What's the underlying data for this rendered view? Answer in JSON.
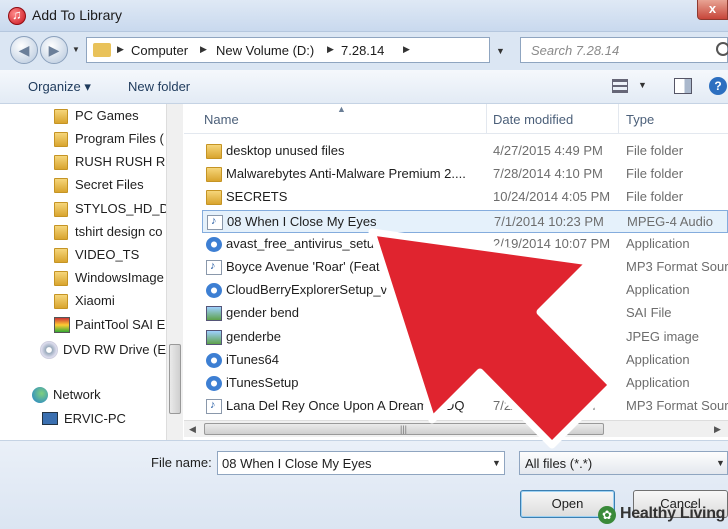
{
  "window": {
    "title": "Add To Library",
    "close_label": "x"
  },
  "nav": {
    "back_glyph": "◀",
    "forward_glyph": "▶",
    "breadcrumbs": [
      "Computer",
      "New Volume (D:)",
      "7.28.14"
    ],
    "search_placeholder": "Search 7.28.14"
  },
  "toolbar": {
    "organize_label": "Organize ▾",
    "new_folder_label": "New folder",
    "help_label": "?"
  },
  "sidebar": {
    "folders": [
      "PC Games",
      "Program Files (",
      "RUSH RUSH RU",
      "Secret Files",
      "STYLOS_HD_DE",
      "tshirt design co",
      "VIDEO_TS",
      "WindowsImage",
      "Xiaomi"
    ],
    "paint_item": "PaintTool SAI E",
    "dvd_item": "DVD RW Drive (E:",
    "network": "Network",
    "pc": "ERVIC-PC"
  },
  "columns": {
    "name": "Name",
    "date": "Date modified",
    "type": "Type"
  },
  "files": [
    {
      "name": "desktop unused files",
      "date": "4/27/2015 4:49 PM",
      "type": "File folder",
      "icon": "folder-icon"
    },
    {
      "name": "Malwarebytes Anti-Malware Premium 2....",
      "date": "7/28/2014 4:10 PM",
      "type": "File folder",
      "icon": "folder-icon"
    },
    {
      "name": "SECRETS",
      "date": "10/24/2014 4:05 PM",
      "type": "File folder",
      "icon": "folder-icon"
    },
    {
      "name": "08 When I Close My Eyes",
      "date": "7/1/2014 10:23 PM",
      "type": "MPEG-4 Audio",
      "icon": "audio-file-icon",
      "selected": true
    },
    {
      "name": "avast_free_antivirus_setup",
      "date": "2/19/2014 10:07 PM",
      "type": "Application",
      "icon": "app-icon"
    },
    {
      "name": "Boyce Avenue  'Roar' (Feat Be",
      "date": "10:48 PM",
      "type": "MP3 Format Sour",
      "icon": "audio-file-icon"
    },
    {
      "name": "CloudBerryExplorerSetup_v3.8.6",
      "date": "",
      "type": "Application",
      "icon": "app-icon"
    },
    {
      "name": "gender bend",
      "date": "",
      "type": "SAI File",
      "icon": "image-file-icon"
    },
    {
      "name": "genderbe",
      "date": "2:10 AM",
      "type": "JPEG image",
      "icon": "image-file-icon"
    },
    {
      "name": "iTunes64",
      "date": "M",
      "type": "Application",
      "icon": "app-icon"
    },
    {
      "name": "iTunesSetup",
      "date": "20/",
      "type": "Application",
      "icon": "app-icon"
    },
    {
      "name": "Lana Del Rey  Once Upon A Dream (CDQ",
      "date": "7/2/2014 8:35 PM",
      "type": "MP3 Format Sour",
      "icon": "audio-file-icon"
    }
  ],
  "bottom": {
    "filename_label": "File name:",
    "filename_value": "08 When I Close My Eyes",
    "filetype_value": "All files (*.*)",
    "open_label": "Open",
    "cancel_label": "Cancel"
  },
  "watermark": {
    "text": "Healthy Living"
  },
  "colors": {
    "arrow_fill": "#e0242f",
    "arrow_stroke": "#ffffff",
    "selection": "#e5f1fb"
  }
}
